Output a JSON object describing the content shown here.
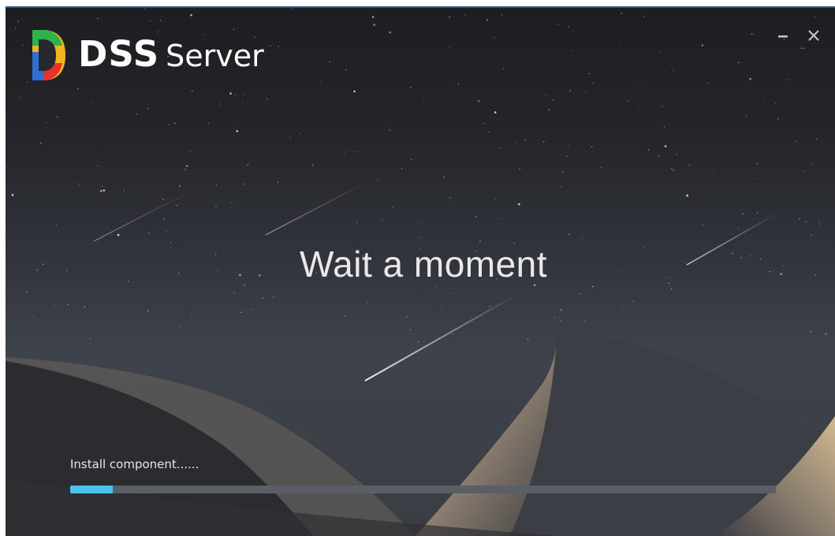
{
  "app": {
    "brand_primary": "DSS",
    "brand_secondary": "Server"
  },
  "window_controls": {
    "minimize_icon": "minimize-icon",
    "close_icon": "close-icon"
  },
  "main": {
    "message": "Wait a moment"
  },
  "install": {
    "status_text": "Install component......",
    "progress_fraction": 0.06
  },
  "colors": {
    "progress_fill": "#4cc2ee",
    "progress_track": "#5a5e66",
    "title_bar_accent": "#2a5b8f"
  }
}
